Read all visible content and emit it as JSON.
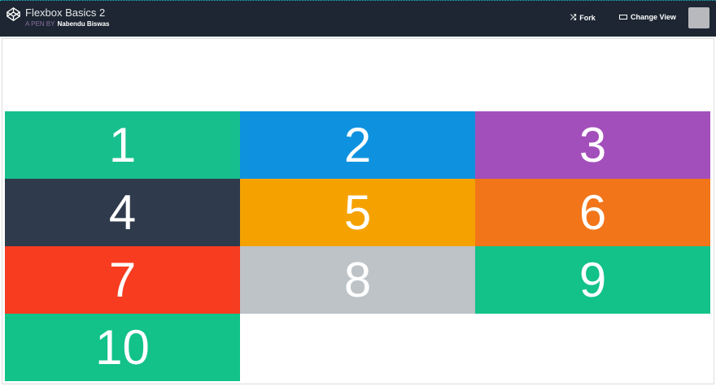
{
  "header": {
    "title": "Flexbox Basics 2",
    "byline_prefix": "A PEN BY",
    "author": "Nabendu Biswas",
    "fork_label": "Fork",
    "change_view_label": "Change View"
  },
  "items": [
    {
      "label": "1",
      "color": "#17bf8d"
    },
    {
      "label": "2",
      "color": "#0e92e0"
    },
    {
      "label": "3",
      "color": "#a34fbb"
    },
    {
      "label": "4",
      "color": "#2f3b4c"
    },
    {
      "label": "5",
      "color": "#f5a200"
    },
    {
      "label": "6",
      "color": "#f2751a"
    },
    {
      "label": "7",
      "color": "#f73c20"
    },
    {
      "label": "8",
      "color": "#bdc3c7"
    },
    {
      "label": "9",
      "color": "#12c289"
    },
    {
      "label": "10",
      "color": "#12c289"
    }
  ]
}
